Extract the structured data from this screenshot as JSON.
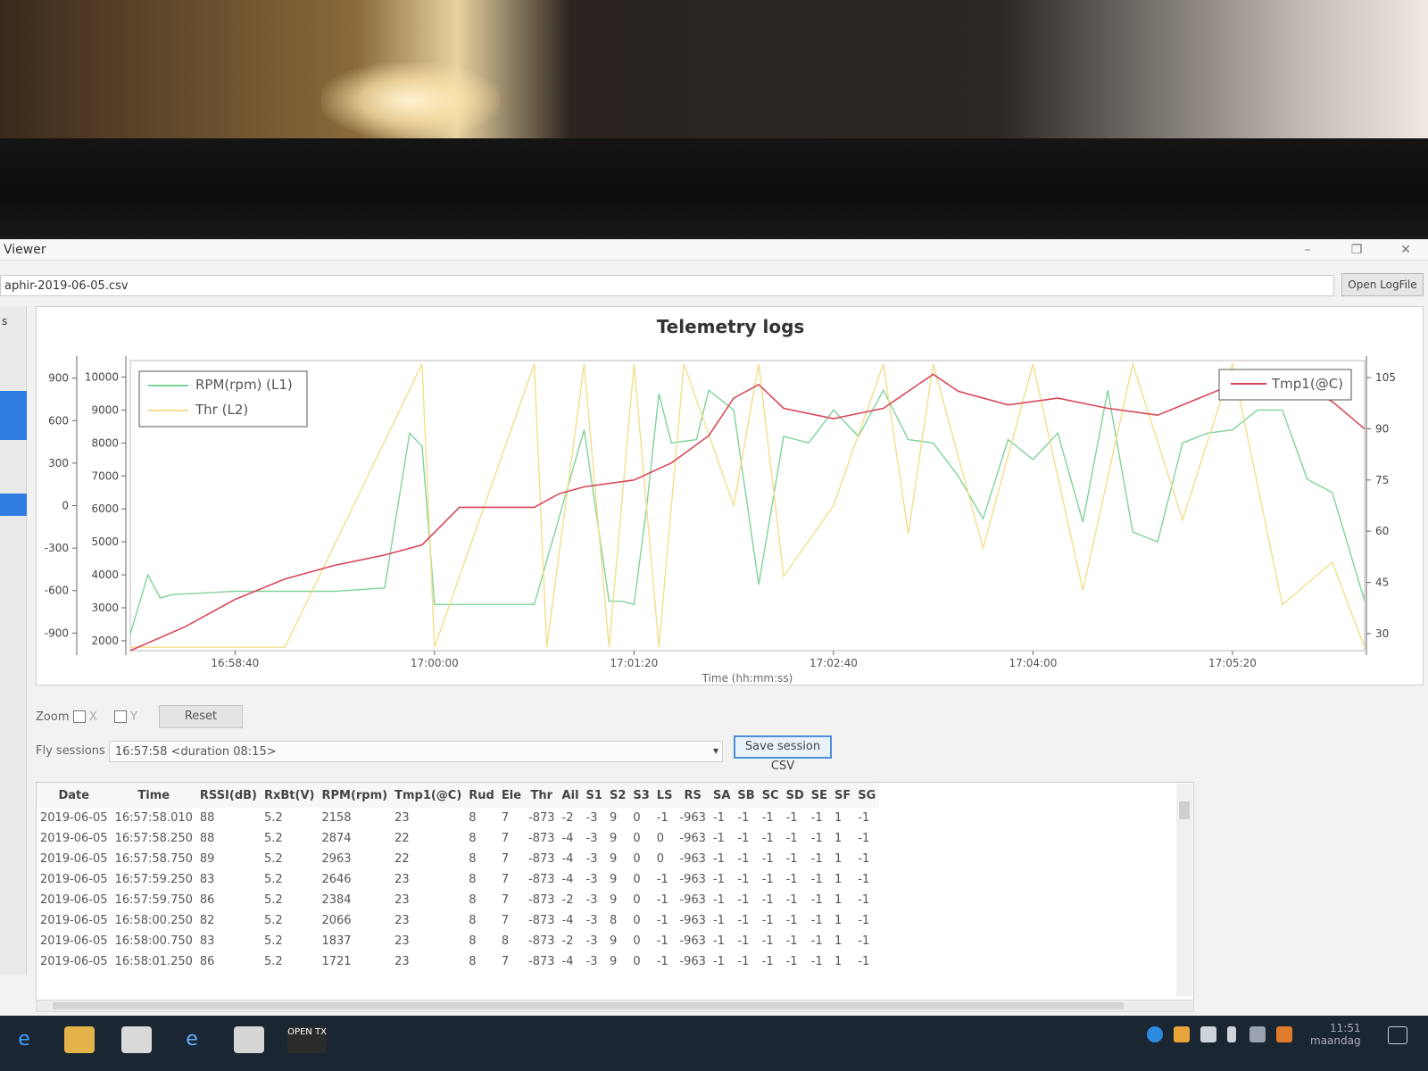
{
  "window": {
    "title": "Viewer",
    "file": "aphir-2019-06-05.csv",
    "open_button": "Open LogFile",
    "sidebar_label": "s"
  },
  "chart_title": "Telemetry logs",
  "chart_data": {
    "type": "line",
    "title": "Telemetry logs",
    "xlabel": "Time (hh:mm:ss)",
    "x_ticks": [
      "16:58:40",
      "17:00:00",
      "17:01:20",
      "17:02:40",
      "17:04:00",
      "17:05:20"
    ],
    "x_range": [
      "16:57:58",
      "17:06:13"
    ],
    "left_axis_outer": {
      "ticks": [
        900,
        600,
        300,
        0,
        -300,
        -600,
        -900
      ],
      "range": [
        -1024,
        1024
      ]
    },
    "left_axis_inner": {
      "ticks": [
        10000,
        9000,
        8000,
        7000,
        6000,
        5000,
        4000,
        3000,
        2000
      ],
      "range": [
        1700,
        10500
      ]
    },
    "right_axis": {
      "ticks": [
        105,
        90,
        75,
        60,
        45,
        30
      ],
      "range": [
        25,
        110
      ]
    },
    "legend_left": [
      "RPM(rpm) (L1)",
      "Thr (L2)"
    ],
    "legend_right": [
      "Tmp1(@C)"
    ],
    "grid": false,
    "series": [
      {
        "name": "RPM(rpm) (L1)",
        "color": "#7fd39a",
        "x": [
          "16:57:58",
          "16:58:05",
          "16:58:10",
          "16:58:15",
          "16:58:40",
          "16:59:20",
          "16:59:40",
          "16:59:50",
          "16:59:55",
          "17:00:00",
          "17:00:40",
          "17:01:00",
          "17:01:10",
          "17:01:15",
          "17:01:20",
          "17:01:25",
          "17:01:30",
          "17:01:35",
          "17:01:45",
          "17:01:50",
          "17:02:00",
          "17:02:10",
          "17:02:20",
          "17:02:30",
          "17:02:40",
          "17:02:50",
          "17:03:00",
          "17:03:10",
          "17:03:20",
          "17:03:30",
          "17:03:40",
          "17:03:50",
          "17:04:00",
          "17:04:10",
          "17:04:20",
          "17:04:30",
          "17:04:40",
          "17:04:50",
          "17:05:00",
          "17:05:10",
          "17:05:20",
          "17:05:30",
          "17:05:40",
          "17:05:50",
          "17:06:00",
          "17:06:13"
        ],
        "values": [
          2200,
          4000,
          3300,
          3400,
          3500,
          3500,
          3600,
          8300,
          7900,
          3100,
          3100,
          8400,
          3200,
          3200,
          3100,
          6000,
          9500,
          8000,
          8100,
          9600,
          9000,
          3700,
          8200,
          8000,
          9000,
          8200,
          9600,
          8100,
          8000,
          7000,
          5700,
          8100,
          7500,
          8300,
          5600,
          9600,
          5300,
          5000,
          8000,
          8300,
          8400,
          9000,
          9000,
          6900,
          6500,
          3200
        ]
      },
      {
        "name": "Thr (L2)",
        "color": "#f1df8c",
        "x": [
          "16:57:58",
          "16:58:40",
          "16:59:00",
          "16:59:55",
          "17:00:00",
          "17:00:40",
          "17:00:45",
          "17:01:00",
          "17:01:10",
          "17:01:20",
          "17:01:30",
          "17:01:40",
          "17:02:00",
          "17:02:10",
          "17:02:20",
          "17:02:40",
          "17:03:00",
          "17:03:10",
          "17:03:20",
          "17:03:40",
          "17:04:00",
          "17:04:20",
          "17:04:40",
          "17:05:00",
          "17:05:20",
          "17:05:40",
          "17:06:00",
          "17:06:13"
        ],
        "values": [
          -1000,
          -1000,
          -1000,
          1000,
          -1000,
          1000,
          -1000,
          1000,
          -1000,
          1000,
          -1000,
          1000,
          0,
          1000,
          -500,
          0,
          1000,
          -200,
          1000,
          -300,
          1000,
          -600,
          1000,
          -100,
          1000,
          -700,
          -400,
          -1000
        ]
      },
      {
        "name": "Tmp1(@C)",
        "color": "#d9475a",
        "x": [
          "16:57:58",
          "16:58:20",
          "16:58:40",
          "16:59:00",
          "16:59:20",
          "16:59:40",
          "16:59:55",
          "17:00:10",
          "17:00:40",
          "17:00:50",
          "17:01:00",
          "17:01:20",
          "17:01:35",
          "17:01:50",
          "17:02:00",
          "17:02:10",
          "17:02:20",
          "17:02:40",
          "17:03:00",
          "17:03:20",
          "17:03:30",
          "17:03:50",
          "17:04:10",
          "17:04:30",
          "17:04:50",
          "17:05:10",
          "17:05:20",
          "17:05:40",
          "17:06:00",
          "17:06:13"
        ],
        "values": [
          25,
          32,
          40,
          46,
          50,
          53,
          56,
          67,
          67,
          71,
          73,
          75,
          80,
          88,
          99,
          103,
          96,
          93,
          96,
          106,
          101,
          97,
          99,
          96,
          94,
          100,
          103,
          106,
          98,
          90
        ]
      }
    ]
  },
  "controls": {
    "zoom_label": "Zoom",
    "x_label": "X",
    "y_label": "Y",
    "reset_label": "Reset",
    "sessions_label": "Fly sessions",
    "sessions_value": "16:57:58 <duration 08:15>",
    "save_label": "Save session CSV"
  },
  "table": {
    "columns": [
      "Date",
      "Time",
      "RSSI(dB)",
      "RxBt(V)",
      "RPM(rpm)",
      "Tmp1(@C)",
      "Rud",
      "Ele",
      "Thr",
      "Ail",
      "S1",
      "S2",
      "S3",
      "LS",
      "RS",
      "SA",
      "SB",
      "SC",
      "SD",
      "SE",
      "SF",
      "SG"
    ],
    "rows": [
      [
        "2019-06-05",
        "16:57:58.010",
        "88",
        "5.2",
        "2158",
        "23",
        "8",
        "7",
        "-873",
        "-2",
        "-3",
        "9",
        "0",
        "-1",
        "-963",
        "-1",
        "-1",
        "-1",
        "-1",
        "-1",
        "1",
        "-1"
      ],
      [
        "2019-06-05",
        "16:57:58.250",
        "88",
        "5.2",
        "2874",
        "22",
        "8",
        "7",
        "-873",
        "-4",
        "-3",
        "9",
        "0",
        "0",
        "-963",
        "-1",
        "-1",
        "-1",
        "-1",
        "-1",
        "1",
        "-1"
      ],
      [
        "2019-06-05",
        "16:57:58.750",
        "89",
        "5.2",
        "2963",
        "22",
        "8",
        "7",
        "-873",
        "-4",
        "-3",
        "9",
        "0",
        "0",
        "-963",
        "-1",
        "-1",
        "-1",
        "-1",
        "-1",
        "1",
        "-1"
      ],
      [
        "2019-06-05",
        "16:57:59.250",
        "83",
        "5.2",
        "2646",
        "23",
        "8",
        "7",
        "-873",
        "-4",
        "-3",
        "9",
        "0",
        "-1",
        "-963",
        "-1",
        "-1",
        "-1",
        "-1",
        "-1",
        "1",
        "-1"
      ],
      [
        "2019-06-05",
        "16:57:59.750",
        "86",
        "5.2",
        "2384",
        "23",
        "8",
        "7",
        "-873",
        "-2",
        "-3",
        "9",
        "0",
        "-1",
        "-963",
        "-1",
        "-1",
        "-1",
        "-1",
        "-1",
        "1",
        "-1"
      ],
      [
        "2019-06-05",
        "16:58:00.250",
        "82",
        "5.2",
        "2066",
        "23",
        "8",
        "7",
        "-873",
        "-4",
        "-3",
        "8",
        "0",
        "-1",
        "-963",
        "-1",
        "-1",
        "-1",
        "-1",
        "-1",
        "1",
        "-1"
      ],
      [
        "2019-06-05",
        "16:58:00.750",
        "83",
        "5.2",
        "1837",
        "23",
        "8",
        "8",
        "-873",
        "-2",
        "-3",
        "9",
        "0",
        "-1",
        "-963",
        "-1",
        "-1",
        "-1",
        "-1",
        "-1",
        "1",
        "-1"
      ],
      [
        "2019-06-05",
        "16:58:01.250",
        "86",
        "5.2",
        "1721",
        "23",
        "8",
        "7",
        "-873",
        "-4",
        "-3",
        "9",
        "0",
        "-1",
        "-963",
        "-1",
        "-1",
        "-1",
        "-1",
        "-1",
        "1",
        "-1"
      ]
    ]
  },
  "taskbar": {
    "time": "11:51",
    "day": "maandag",
    "opentx_label": "OPEN TX"
  }
}
